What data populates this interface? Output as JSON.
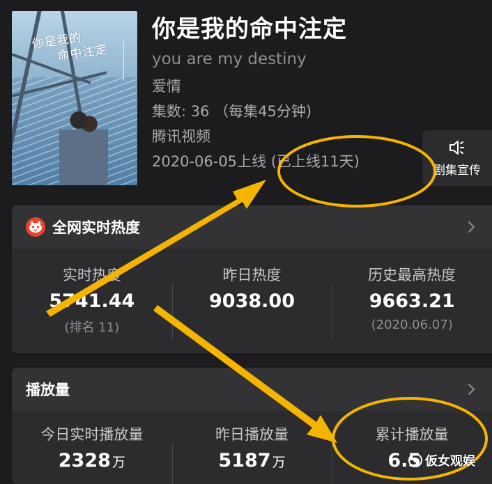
{
  "show": {
    "title": "你是我的命中注定",
    "subtitle": "you are my destiny",
    "genre": "爱情",
    "episodes": "集数: 36 （每集45分钟)",
    "platform": "腾讯视频",
    "release": "2020-06-05上线 (已上线11天)",
    "poster_title_line1": "你是我的",
    "poster_title_line2": "命中注定"
  },
  "promo": {
    "label": "剧集宣传",
    "icon": "speaker-icon"
  },
  "heat_card": {
    "title": "全网实时热度",
    "logo": "cat-logo",
    "stats": [
      {
        "label": "实时热度",
        "value": "5741.44",
        "sub": "(排名 11)"
      },
      {
        "label": "昨日热度",
        "value": "9038.00",
        "sub": ""
      },
      {
        "label": "历史最高热度",
        "value": "9663.21",
        "sub": "(2020.06.07)"
      }
    ]
  },
  "play_card": {
    "title": "播放量",
    "stats": [
      {
        "label": "今日实时播放量",
        "value": "2328",
        "unit": "万"
      },
      {
        "label": "昨日播放量",
        "value": "5187",
        "unit": "万"
      },
      {
        "label": "累计播放量",
        "value": "6.5",
        "unit": ""
      }
    ]
  },
  "watermark": {
    "text": "仮女观娱"
  },
  "colors": {
    "background": "#1c1c1e",
    "card": "#2c2c2e",
    "annotation": "#f5b400",
    "muted_text": "#8d8d93"
  }
}
